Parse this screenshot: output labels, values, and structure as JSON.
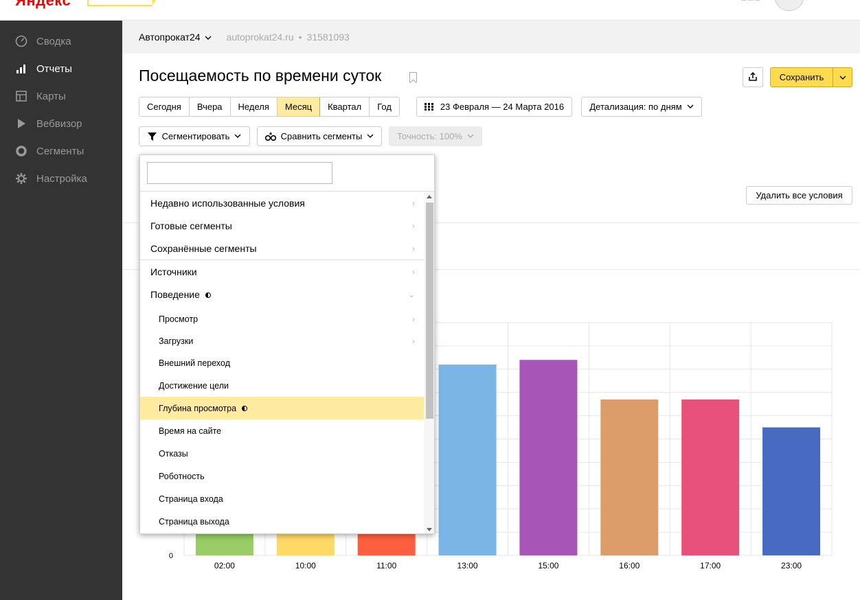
{
  "topbar": {
    "logo": "Яндекс",
    "apps_icon": "apps-grid-icon"
  },
  "sidebar": {
    "items": [
      {
        "label": "Сводка",
        "icon": "dashboard-icon"
      },
      {
        "label": "Отчеты",
        "icon": "bar-chart-icon",
        "active": true
      },
      {
        "label": "Карты",
        "icon": "map-icon"
      },
      {
        "label": "Вебвизор",
        "icon": "play-icon"
      },
      {
        "label": "Сегменты",
        "icon": "segments-icon"
      },
      {
        "label": "Настройка",
        "icon": "gear-icon"
      }
    ]
  },
  "counter": {
    "name": "Автопрокат24",
    "site": "autoprokat24.ru",
    "dot": "•",
    "id": "31581093"
  },
  "header": {
    "title": "Посещаемость по времени суток",
    "save_label": "Сохранить"
  },
  "periods": [
    "Сегодня",
    "Вчера",
    "Неделя",
    "Месяц",
    "Квартал",
    "Год"
  ],
  "active_period": "Месяц",
  "date_range": "23 Февраля — 24 Марта 2016",
  "detail_label": "Детализация: по дням",
  "segment_label": "Сегментировать",
  "compare_label": "Сравнить сегменты",
  "accuracy_label": "Точность: 100%",
  "delete_conditions_label": "Удалить все условия",
  "dropdown": {
    "search_value": "",
    "groups": [
      {
        "label": "Недавно использованные условия",
        "arrow": "›"
      },
      {
        "label": "Готовые сегменты",
        "arrow": "›"
      },
      {
        "label": "Сохранённые сегменты",
        "arrow": "›"
      },
      {
        "label": "Источники",
        "arrow": "›"
      },
      {
        "label": "Поведение",
        "arrow": "⌄"
      }
    ],
    "behavior_items": [
      {
        "label": "Просмотр",
        "arrow": "›"
      },
      {
        "label": "Загрузки",
        "arrow": "›"
      },
      {
        "label": "Внешний переход",
        "arrow": ""
      },
      {
        "label": "Достижение цели",
        "arrow": ""
      },
      {
        "label": "Глубина просмотра",
        "arrow": "",
        "highlighted": true
      },
      {
        "label": "Время на сайте",
        "arrow": ""
      },
      {
        "label": "Отказы",
        "arrow": ""
      },
      {
        "label": "Роботность",
        "arrow": ""
      },
      {
        "label": "Страница входа",
        "arrow": ""
      },
      {
        "label": "Страница выхода",
        "arrow": ""
      }
    ]
  },
  "chart_data": {
    "type": "bar",
    "categories": [
      "02:00",
      "10:00",
      "11:00",
      "13:00",
      "15:00",
      "16:00",
      "17:00",
      "23:00"
    ],
    "values": [
      null,
      null,
      null,
      8.2,
      8.4,
      6.7,
      6.7,
      5.5
    ],
    "colors": [
      "#99cc66",
      "#ffd966",
      "#ff5f3f",
      "#7ab5e6",
      "#a855b8",
      "#dd9d6a",
      "#e8527a",
      "#4769bf"
    ],
    "y_tick_labels": [
      "0"
    ],
    "ylim": [
      0,
      10
    ],
    "grid": true
  }
}
